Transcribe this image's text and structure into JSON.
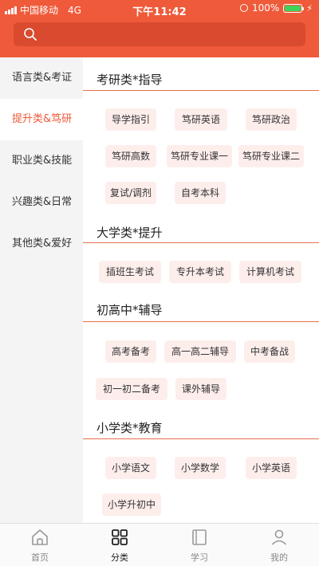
{
  "status_bar": {
    "carrier": "中国移动",
    "network": "4G",
    "time": "下午11:42",
    "battery": "100%"
  },
  "search": {
    "placeholder": ""
  },
  "sidebar": {
    "items": [
      {
        "label": "语言类&考证",
        "active": false
      },
      {
        "label": "提升类&笃研",
        "active": true
      },
      {
        "label": "职业类&技能",
        "active": false
      },
      {
        "label": "兴趣类&日常",
        "active": false
      },
      {
        "label": "其他类&爱好",
        "active": false
      }
    ]
  },
  "sections": [
    {
      "title": "考研类*指导",
      "tags": [
        "导学指引",
        "笃研英语",
        "笃研政治",
        "笃研高数",
        "笃研专业课一",
        "笃研专业课二",
        "复试/调剂",
        "自考本科"
      ]
    },
    {
      "title": "大学类*提升",
      "tags": [
        "插班生考试",
        "专升本考试",
        "计算机考试"
      ]
    },
    {
      "title": "初高中*辅导",
      "tags": [
        "高考备考",
        "高一高二辅导",
        "中考备战",
        "初一初二备考",
        "课外辅导"
      ]
    },
    {
      "title": "小学类*教育",
      "tags": [
        "小学语文",
        "小学数学",
        "小学英语",
        "小学升初中"
      ]
    }
  ],
  "tabbar": {
    "tabs": [
      {
        "label": "首页",
        "icon": "home-icon",
        "active": false
      },
      {
        "label": "分类",
        "icon": "category-icon",
        "active": true
      },
      {
        "label": "学习",
        "icon": "book-icon",
        "active": false
      },
      {
        "label": "我的",
        "icon": "profile-icon",
        "active": false
      }
    ]
  },
  "colors": {
    "accent": "#ef5a3a",
    "tag_bg": "#fdeeec",
    "sidebar_bg": "#f4f4f4"
  }
}
